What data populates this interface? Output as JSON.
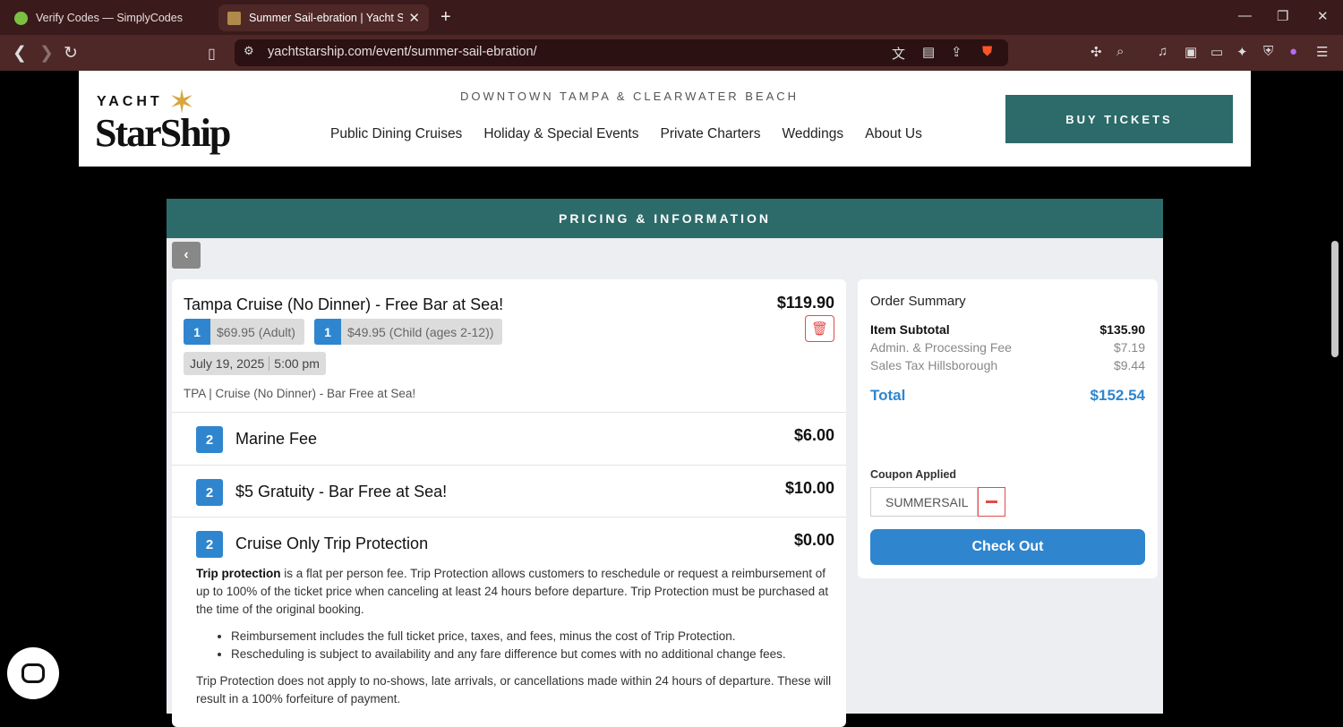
{
  "browser": {
    "tabs": [
      {
        "title": "Verify Codes — SimplyCodes",
        "active": false
      },
      {
        "title": "Summer Sail-ebration | Yacht StarShip",
        "active": true
      }
    ],
    "url": "yachtstarship.com/event/summer-sail-ebration/",
    "shield_count": "5"
  },
  "header": {
    "logo_top": "YACHT",
    "logo_main": "StarShip",
    "tagline": "DOWNTOWN TAMPA & CLEARWATER BEACH",
    "nav": [
      "Public Dining Cruises",
      "Holiday & Special Events",
      "Private Charters",
      "Weddings",
      "About Us"
    ],
    "buy_tickets": "BUY TICKETS"
  },
  "panel": {
    "title": "PRICING & INFORMATION"
  },
  "item": {
    "title": "Tampa Cruise (No Dinner) - Free Bar at Sea!",
    "price": "$119.90",
    "tickets": [
      {
        "qty": "1",
        "label": "$69.95 (Adult)"
      },
      {
        "qty": "1",
        "label": "$49.95 (Child (ages 2-12))"
      }
    ],
    "date": "July 19, 2025",
    "time": "5:00 pm",
    "description": "TPA | Cruise (No Dinner) - Bar Free at Sea!"
  },
  "addons": [
    {
      "qty": "2",
      "label": "Marine Fee",
      "amount": "$6.00"
    },
    {
      "qty": "2",
      "label": "$5 Gratuity - Bar Free at Sea!",
      "amount": "$10.00"
    },
    {
      "qty": "2",
      "label": "Cruise Only Trip Protection",
      "amount": "$0.00"
    }
  ],
  "trip_protection": {
    "lead": "Trip protection",
    "text": " is a flat per person fee. Trip Protection allows customers to reschedule or request a reimbursement of up to 100% of the ticket price when canceling at least 24 hours before departure. Trip Protection must be purchased at the time of the original booking.",
    "bullets": [
      "Reimbursement includes the full ticket price, taxes, and fees, minus the cost of Trip Protection.",
      "Rescheduling is subject to availability and any fare difference but comes with no additional change fees."
    ],
    "footer": "Trip Protection does not apply to no-shows, late arrivals, or cancellations made within 24 hours of departure. These will result in a 100% forfeiture of payment."
  },
  "summary": {
    "title": "Order Summary",
    "subtotal_label": "Item Subtotal",
    "subtotal": "$135.90",
    "fee_label": "Admin. & Processing Fee",
    "fee": "$7.19",
    "tax_label": "Sales Tax Hillsborough",
    "tax": "$9.44",
    "total_label": "Total",
    "total": "$152.54",
    "coupon_label": "Coupon Applied",
    "coupon_code": "SUMMERSAIL",
    "checkout": "Check Out"
  },
  "colors": {
    "teal": "#2d6a6a",
    "blue": "#2f86cf",
    "red": "#e34b4b",
    "chrome": "#4e2727"
  }
}
